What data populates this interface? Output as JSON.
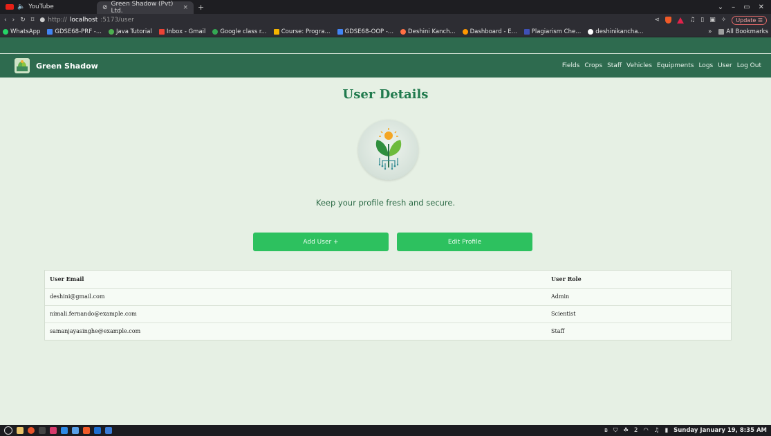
{
  "browser": {
    "tabs": [
      {
        "label": "YouTube",
        "active": false
      },
      {
        "label": "Green Shadow (Pvt) Ltd.",
        "active": true
      }
    ],
    "url_host": "localhost",
    "url_prefix": "http://",
    "url_rest": ":5173/user",
    "update_label": "Update",
    "bookmarks": [
      {
        "label": "WhatsApp",
        "color": "#25d366"
      },
      {
        "label": "GDSE68-PRF -...",
        "color": "#4285f4"
      },
      {
        "label": "Java Tutorial",
        "color": "#4caf50"
      },
      {
        "label": "Inbox - Gmail",
        "color": "#ea4335"
      },
      {
        "label": "Google class r...",
        "color": "#34a853"
      },
      {
        "label": "Course: Progra...",
        "color": "#f4b400"
      },
      {
        "label": "GDSE68-OOP -...",
        "color": "#4285f4"
      },
      {
        "label": "Deshini Kanch...",
        "color": "#ff7043"
      },
      {
        "label": "Dashboard - E...",
        "color": "#ff9800"
      },
      {
        "label": "Plagiarism Che...",
        "color": "#3f51b5"
      },
      {
        "label": "deshinikancha...",
        "color": "#ffffff"
      }
    ],
    "all_bookmarks": "All Bookmarks",
    "overflow": "»"
  },
  "app": {
    "brand": "Green Shadow",
    "nav": [
      "Fields",
      "Crops",
      "Staff",
      "Vehicles",
      "Equipments",
      "Logs",
      "User",
      "Log Out"
    ]
  },
  "page": {
    "title": "User Details",
    "tagline": "Keep your profile fresh and secure.",
    "add_user_label": "Add User +",
    "edit_profile_label": "Edit Profile"
  },
  "table": {
    "headers": {
      "email": "User Email",
      "role": "User Role"
    },
    "rows": [
      {
        "email": "deshini@gmail.com",
        "role": "Admin"
      },
      {
        "email": "nimali.fernando@example.com",
        "role": "Scientist"
      },
      {
        "email": "samanjayasinghe@example.com",
        "role": "Staff"
      }
    ]
  },
  "taskbar": {
    "clock": "Sunday January 19, 8:35 AM",
    "wifi_count": "2"
  },
  "colors": {
    "nav_bg": "#2e6b4f",
    "button_bg": "#2dc15f",
    "title": "#207a4d",
    "page_bg": "#e6f0e4"
  }
}
